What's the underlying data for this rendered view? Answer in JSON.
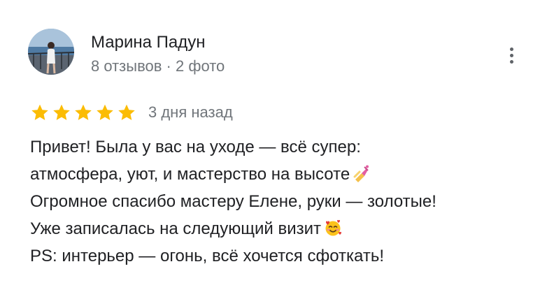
{
  "review": {
    "author_name": "Марина Падун",
    "author_meta": "8 отзывов · 2 фото",
    "rating": 5,
    "rating_max": 5,
    "date": "3 дня назад",
    "star_color": "#fbbc04",
    "icons": {
      "avatar": "user-photo",
      "more": "more-vert-icon",
      "star": "star-icon",
      "line2_emoji": "nail-polish-emoji",
      "line4_emoji": "smiling-face-with-hearts-emoji"
    },
    "text_lines": [
      "Привет! Была у вас на уходе — всё супер:",
      "атмосфера, уют, и мастерство на высоте",
      "Огромное спасибо мастеру Елене, руки — золотые!",
      "Уже записалась на следующий визит",
      "PS: интерьер — огонь, всё хочется сфоткать!"
    ]
  }
}
